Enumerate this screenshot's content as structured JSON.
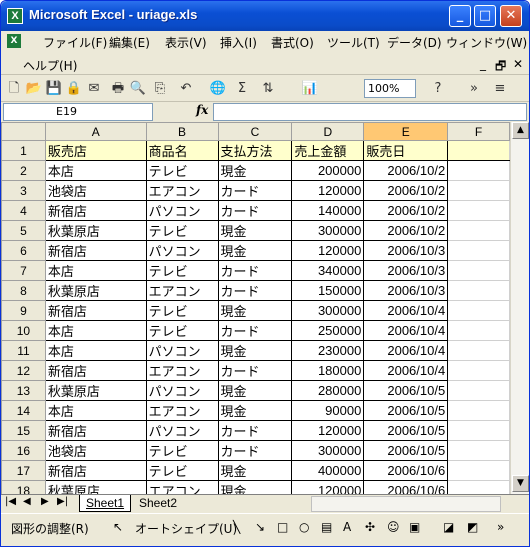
{
  "window": {
    "title": "Microsoft Excel - uriage.xls",
    "app_icon_letter": "X"
  },
  "menu": {
    "items": [
      "ファイル(F)",
      "編集(E)",
      "表示(V)",
      "挿入(I)",
      "書式(O)",
      "ツール(T)",
      "データ(D)",
      "ウィンドウ(W)"
    ],
    "help": "ヘルプ(H)"
  },
  "toolbar": {
    "zoom": "100%"
  },
  "formula_bar": {
    "cell_ref": "E19",
    "fx": "fx",
    "content": ""
  },
  "sheet": {
    "columns": [
      "A",
      "B",
      "C",
      "D",
      "E",
      "F"
    ],
    "header": [
      "販売店",
      "商品名",
      "支払方法",
      "売上金額",
      "販売日"
    ],
    "rows": [
      [
        "本店",
        "テレビ",
        "現金",
        "200000",
        "2006/10/2"
      ],
      [
        "池袋店",
        "エアコン",
        "カード",
        "120000",
        "2006/10/2"
      ],
      [
        "新宿店",
        "パソコン",
        "カード",
        "140000",
        "2006/10/2"
      ],
      [
        "秋葉原店",
        "テレビ",
        "現金",
        "300000",
        "2006/10/2"
      ],
      [
        "新宿店",
        "パソコン",
        "現金",
        "120000",
        "2006/10/3"
      ],
      [
        "本店",
        "テレビ",
        "カード",
        "340000",
        "2006/10/3"
      ],
      [
        "秋葉原店",
        "エアコン",
        "カード",
        "150000",
        "2006/10/3"
      ],
      [
        "新宿店",
        "テレビ",
        "現金",
        "300000",
        "2006/10/4"
      ],
      [
        "本店",
        "テレビ",
        "カード",
        "250000",
        "2006/10/4"
      ],
      [
        "本店",
        "パソコン",
        "現金",
        "230000",
        "2006/10/4"
      ],
      [
        "新宿店",
        "エアコン",
        "カード",
        "180000",
        "2006/10/4"
      ],
      [
        "秋葉原店",
        "パソコン",
        "現金",
        "280000",
        "2006/10/5"
      ],
      [
        "本店",
        "エアコン",
        "現金",
        "90000",
        "2006/10/5"
      ],
      [
        "新宿店",
        "パソコン",
        "カード",
        "120000",
        "2006/10/5"
      ],
      [
        "池袋店",
        "テレビ",
        "カード",
        "300000",
        "2006/10/5"
      ],
      [
        "新宿店",
        "テレビ",
        "現金",
        "400000",
        "2006/10/6"
      ],
      [
        "秋葉原店",
        "エアコン",
        "現金",
        "120000",
        "2006/10/6"
      ]
    ],
    "row_numbers": [
      "1",
      "2",
      "3",
      "4",
      "5",
      "6",
      "7",
      "8",
      "9",
      "10",
      "11",
      "12",
      "13",
      "14",
      "15",
      "16",
      "17",
      "18",
      "19",
      "20"
    ],
    "tabs": [
      "Sheet1",
      "Sheet2"
    ]
  },
  "drawing_toolbar": {
    "draw_label": "図形の調整(R)",
    "autoshape_label": "オートシェイプ(U)"
  },
  "colors": {
    "title_blue": "#0a4fd4",
    "header_fill": "#ffffcc",
    "selected_header": "#ffc873"
  }
}
